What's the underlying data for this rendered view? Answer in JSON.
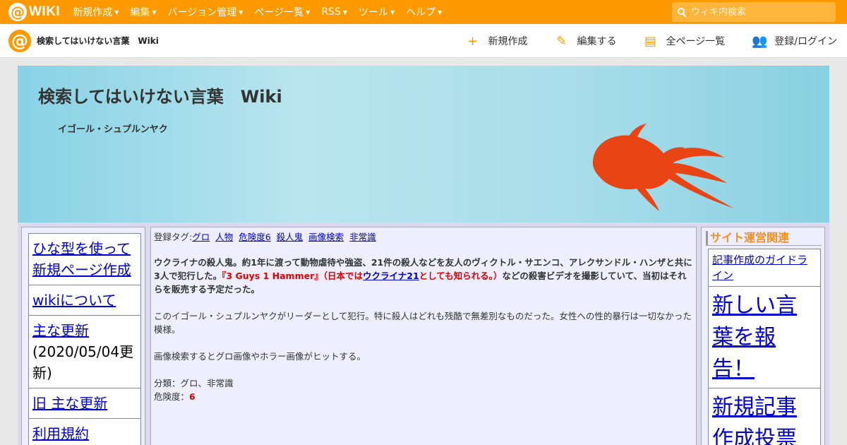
{
  "topbar": {
    "logo_mark": "@",
    "logo_text": "WIKI",
    "menu": [
      "新規作成",
      "編集",
      "バージョン管理",
      "ページ一覧",
      "RSS",
      "ツール",
      "ヘルプ"
    ],
    "search_placeholder": "ウィキ内検索"
  },
  "subbar": {
    "site_logo": "@",
    "site_name": "検索してはいけない言葉　Wiki",
    "actions": [
      {
        "icon": "plus-icon",
        "glyph": "+",
        "label": "新規作成"
      },
      {
        "icon": "pencil-icon",
        "glyph": "✎",
        "label": "編集する"
      },
      {
        "icon": "page-icon",
        "glyph": "▤",
        "label": "全ページ一覧"
      },
      {
        "icon": "user-add-icon",
        "glyph": "👥",
        "label": "登録/ログイン"
      }
    ]
  },
  "header": {
    "title": "検索してはいけない言葉　Wiki",
    "subtitle": "イゴール・シュプルンヤク"
  },
  "left_nav": [
    {
      "link": "ひな型を使って新規ページ作成",
      "note": ""
    },
    {
      "link": "wikiについて",
      "note": ""
    },
    {
      "link": "主な更新",
      "note": "(2020/05/04更新)"
    },
    {
      "link": "旧 主な更新",
      "note": ""
    },
    {
      "link": "利用規約",
      "note": ""
    }
  ],
  "content": {
    "tags_label": "登録タグ:",
    "tags": [
      "グロ",
      "人物",
      "危険度6",
      "殺人鬼",
      "画像検索",
      "非常識"
    ],
    "p1_bold": "ウクライナの殺人鬼。約1年に渡って動物虐待や強盗、21件の殺人などを友人のヴィクトル・サエンコ、アレクサンドル・ハンザと共に3人で犯行した。",
    "p1_red1": "『3 Guys 1 Hammer』（日本では",
    "p1_link": "ウクライナ21",
    "p1_red2": "としても知られる。）",
    "p1_bold2": "などの殺害ビデオを撮影していて、当初はそれらを販売する予定だった。",
    "p2": "このイゴール・シュプルンヤクがリーダーとして犯行。特に殺人はどれも残酷で無差別なものだった。女性への性的暴行は一切なかった模様。",
    "p3": "画像検索するとグロ画像やホラー画像がヒットする。",
    "category": "分類：グロ、非常識",
    "danger_label": "危険度：",
    "danger_value": "6"
  },
  "right_nav": {
    "heading": "サイト運営関連",
    "items": [
      "記事作成のガイドライン",
      "新しい言葉を報告！",
      "新規記事作成投票"
    ]
  },
  "colors": {
    "brand": "#ff9900",
    "link": "#0000cc",
    "danger": "#e00000",
    "fish": "#e84414"
  }
}
